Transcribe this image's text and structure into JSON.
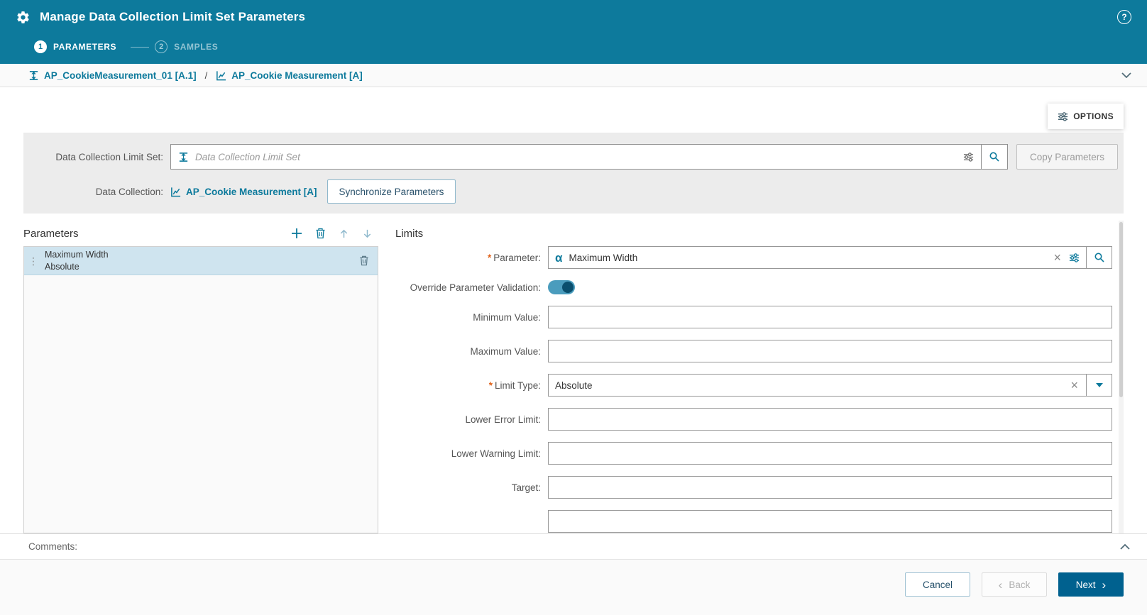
{
  "colors": {
    "header_bg": "#0d7a9c",
    "accent": "#0d7a9c",
    "primary_button": "#00618f",
    "selected_row": "#cfe4ef",
    "panel_bg": "#ececec"
  },
  "icons": {
    "help": "?",
    "alpha": "α",
    "clear": "×",
    "drag": "⋮"
  },
  "header": {
    "title": "Manage Data Collection Limit Set Parameters"
  },
  "wizard": {
    "step1_number": "1",
    "step1_label": "PARAMETERS",
    "step2_number": "2",
    "step2_label": "SAMPLES"
  },
  "breadcrumb": {
    "item1": "AP_CookieMeasurement_01 [A.1]",
    "separator": "/",
    "item2": "AP_Cookie Measurement [A]"
  },
  "options_tab": {
    "label": "OPTIONS"
  },
  "top_panel": {
    "limit_set_label": "Data Collection Limit Set:",
    "limit_set_placeholder": "Data Collection Limit Set",
    "copy_parameters_label": "Copy Parameters",
    "data_collection_label": "Data Collection:",
    "data_collection_value": "AP_Cookie Measurement [A]",
    "synchronize_label": "Synchronize Parameters"
  },
  "parameters_panel": {
    "title": "Parameters",
    "items": [
      {
        "name": "Maximum Width",
        "limit_type": "Absolute",
        "selected": true
      }
    ]
  },
  "limits_panel": {
    "title": "Limits",
    "required_marker": "*",
    "parameter_label": "Parameter:",
    "parameter_value": "Maximum Width",
    "override_label": "Override Parameter Validation:",
    "override_on": true,
    "minimum_value_label": "Minimum Value:",
    "minimum_value": "",
    "maximum_value_label": "Maximum Value:",
    "maximum_value": "",
    "limit_type_label": "Limit Type:",
    "limit_type_value": "Absolute",
    "lower_error_label": "Lower Error Limit:",
    "lower_error_value": "",
    "lower_warning_label": "Lower Warning Limit:",
    "lower_warning_value": "",
    "target_label": "Target:",
    "target_value": ""
  },
  "comments": {
    "label": "Comments:"
  },
  "footer": {
    "cancel_label": "Cancel",
    "back_chevron": "‹",
    "back_label": "Back",
    "next_label": "Next",
    "next_chevron": "›"
  }
}
